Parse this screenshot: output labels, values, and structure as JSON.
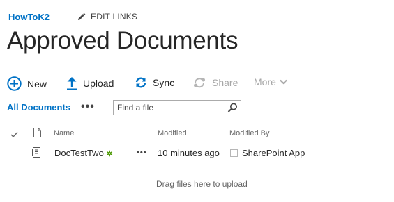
{
  "header": {
    "site_title": "HowToK2",
    "edit_links_label": "EDIT LINKS",
    "page_title": "Approved Documents"
  },
  "commands": {
    "new_label": "New",
    "upload_label": "Upload",
    "sync_label": "Sync",
    "share_label": "Share",
    "more_label": "More"
  },
  "views": {
    "current_view": "All Documents",
    "more_views": "•••"
  },
  "search": {
    "placeholder": "Find a file"
  },
  "table": {
    "columns": {
      "name": "Name",
      "modified": "Modified",
      "modified_by": "Modified By"
    },
    "rows": [
      {
        "name": "DocTestTwo",
        "new_indicator": "✲",
        "ellipsis": "•••",
        "modified": "10 minutes ago",
        "modified_by": "SharePoint App"
      }
    ]
  },
  "drag_drop_text": "Drag files here to upload",
  "colors": {
    "accent": "#0072c6",
    "new_item": "#4e9a06",
    "disabled": "#a6a6a6"
  }
}
